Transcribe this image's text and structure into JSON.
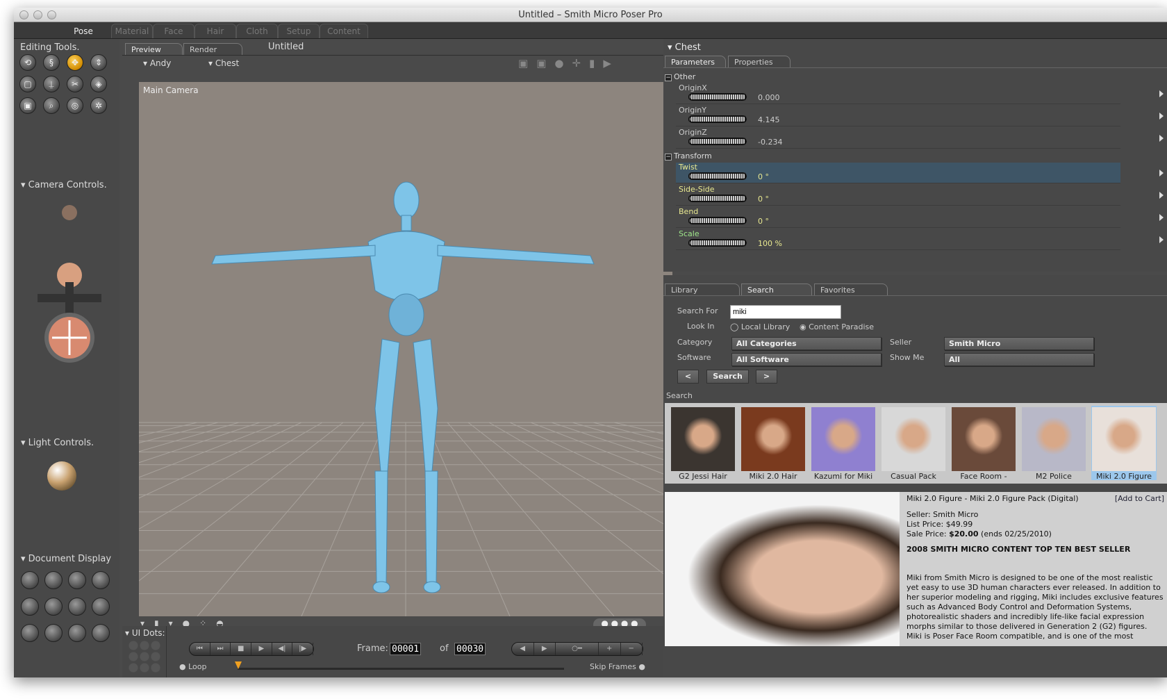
{
  "window": {
    "title": "Untitled – Smith Micro Poser Pro"
  },
  "rooms": [
    {
      "label": "Pose",
      "active": true
    },
    {
      "label": "Material"
    },
    {
      "label": "Face"
    },
    {
      "label": "Hair"
    },
    {
      "label": "Cloth"
    },
    {
      "label": "Setup"
    },
    {
      "label": "Content"
    }
  ],
  "left": {
    "editing_tools": "Editing Tools.",
    "camera_controls": "Camera Controls.",
    "light_controls": "Light Controls.",
    "document_display": "Document Display",
    "ui_dots": "UI Dots:",
    "tools": [
      "rotate-icon",
      "twist-icon",
      "translate-icon",
      "translate-in-out-icon",
      "scale-icon",
      "taper-icon",
      "chain-break-icon",
      "color-icon",
      "grouping-icon",
      "view-magnifier-icon",
      "morphing-tool-icon",
      "direct-manipulation-icon"
    ]
  },
  "doc": {
    "tabs": [
      "Preview",
      "Render"
    ],
    "doc_title": "Untitled",
    "figure": "Andy",
    "actor": "Chest",
    "camera": "Main Camera"
  },
  "anim": {
    "frame_label": "Frame:",
    "frame": "00001",
    "of": "of",
    "total": "00030",
    "loop": "Loop",
    "skip": "Skip Frames"
  },
  "params": {
    "actor": "Chest",
    "tabs": [
      "Parameters",
      "Properties"
    ],
    "groups": [
      {
        "name": "Other",
        "items": [
          {
            "label": "OriginX",
            "value": "0.000"
          },
          {
            "label": "OriginY",
            "value": "4.145"
          },
          {
            "label": "OriginZ",
            "value": "-0.234"
          }
        ]
      },
      {
        "name": "Transform",
        "items": [
          {
            "label": "Twist",
            "value": "0 °",
            "selected": true
          },
          {
            "label": "Side-Side",
            "value": "0 °"
          },
          {
            "label": "Bend",
            "value": "0 °"
          },
          {
            "label": "Scale",
            "value": "100 %"
          }
        ]
      }
    ]
  },
  "library": {
    "tabs": [
      "Library",
      "Search",
      "Favorites"
    ],
    "search_for_label": "Search For",
    "search_value": "miki",
    "look_in_label": "Look In",
    "local": "Local Library",
    "paradise": "Content Paradise",
    "category_label": "Category",
    "category": "All Categories",
    "software_label": "Software",
    "software": "All Software",
    "seller_label": "Seller",
    "seller": "Smith Micro",
    "showme_label": "Show Me",
    "showme": "All",
    "prev": "<",
    "search_btn": "Search",
    "next": ">",
    "results_label": "Search",
    "results": [
      {
        "label": "G2 Jessi Hair",
        "color": "#3b3530"
      },
      {
        "label": "Miki 2.0 Hair",
        "color": "#7a3a1e"
      },
      {
        "label": "Kazumi for Miki",
        "color": "#8f80d0"
      },
      {
        "label": "Casual Pack",
        "color": "#d8d8d8"
      },
      {
        "label": "Face Room -",
        "color": "#6a4a3a"
      },
      {
        "label": "M2 Police",
        "color": "#b8b8c8"
      },
      {
        "label": "Miki 2.0 Figure",
        "color": "#e8e0da",
        "selected": true
      }
    ],
    "detail": {
      "title": "Miki 2.0 Figure - Miki 2.0 Figure Pack (Digital)",
      "cart": "[Add to Cart]",
      "seller": "Seller: Smith Micro",
      "list": "List Price: $49.99",
      "sale_prefix": "Sale Price: ",
      "sale": "$20.00",
      "sale_suffix": " (ends 02/25/2010)",
      "headline": "2008 SMITH MICRO CONTENT TOP TEN BEST SELLER",
      "body": "Miki from Smith Micro is designed to be one of the most realistic yet easy to use 3D human characters ever released. In addition to her superior modeling and rigging, Miki includes exclusive features such as Advanced Body Control and Deformation Systems, photorealistic shaders and incredibly life-like facial expression morphs similar to those delivered in Generation 2 (G2) figures. Miki is Poser Face Room compatible, and is one of the most"
    }
  }
}
